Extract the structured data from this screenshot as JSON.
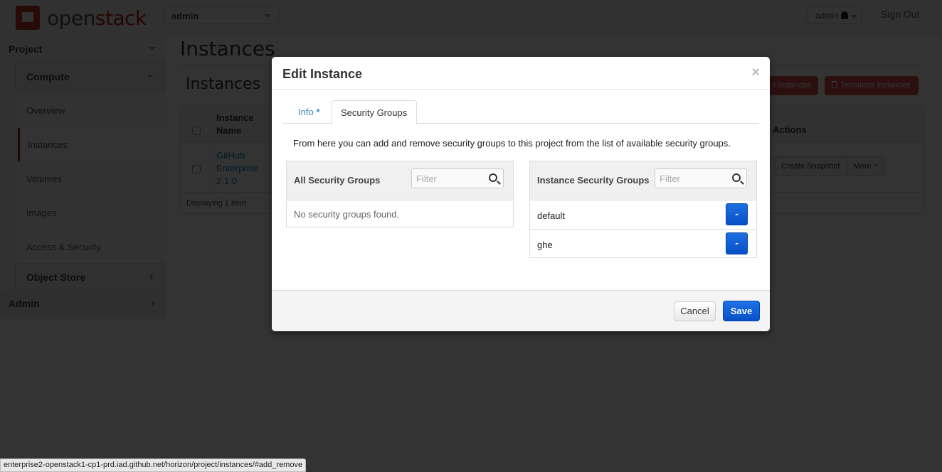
{
  "header": {
    "logo_prefix": "open",
    "logo_suffix": "stack",
    "project_select": "admin",
    "user_menu": "admin",
    "sign_out": "Sign Out"
  },
  "sidebar": {
    "project": "Project",
    "compute": "Compute",
    "items": [
      {
        "label": "Overview",
        "active": false
      },
      {
        "label": "Instances",
        "active": true
      },
      {
        "label": "Volumes",
        "active": false
      },
      {
        "label": "Images",
        "active": false
      },
      {
        "label": "Access & Security",
        "active": false
      }
    ],
    "object_store": "Object Store",
    "admin": "Admin"
  },
  "page": {
    "title": "Instances",
    "section_title": "Instances",
    "soft_reboot_label": "t Instances",
    "terminate_label": "Terminate Instances",
    "table": {
      "columns": [
        "Instance Name",
        "Actions"
      ],
      "rows": [
        {
          "name": "GitHub Enterprise 2.1.0",
          "action_primary": "Create Snapshot",
          "action_more": "More"
        }
      ],
      "footer": "Displaying 1 item"
    }
  },
  "modal": {
    "title": "Edit Instance",
    "close": "×",
    "tabs": [
      {
        "label": "Info",
        "required_marker": "*",
        "active": false
      },
      {
        "label": "Security Groups",
        "active": true
      }
    ],
    "help_text": "From here you can add and remove security groups to this project from the list of available security groups.",
    "all_groups": {
      "title": "All Security Groups",
      "filter_placeholder": "Filter",
      "empty_message": "No security groups found."
    },
    "instance_groups": {
      "title": "Instance Security Groups",
      "filter_placeholder": "Filter",
      "items": [
        {
          "name": "default",
          "button": "-"
        },
        {
          "name": "ghe",
          "button": "-"
        }
      ]
    },
    "cancel_label": "Cancel",
    "save_label": "Save"
  },
  "status_bar": {
    "url": "enterprise2-openstack1-cp1-prd.iad.github.net/horizon/project/instances/#add_remove"
  },
  "colors": {
    "brand_red": "#b22222",
    "primary_blue": "#0650c8",
    "link_blue": "#3b8bc4"
  }
}
